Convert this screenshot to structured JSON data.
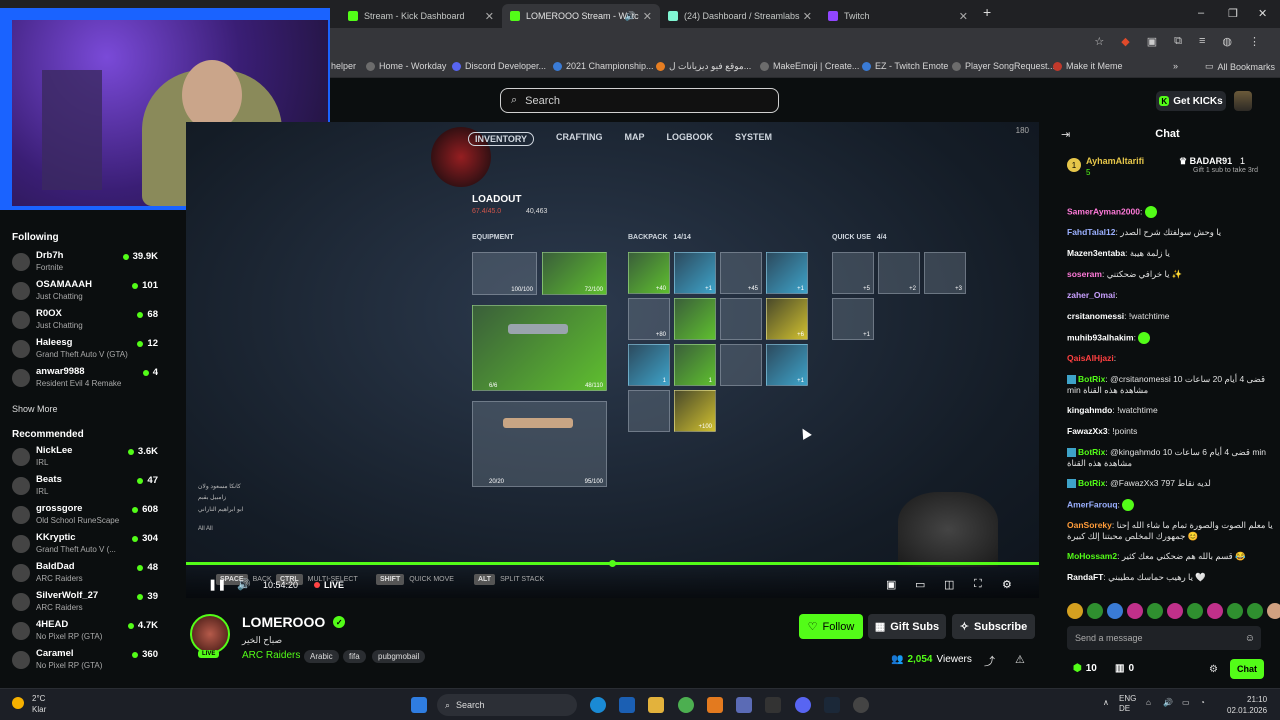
{
  "browser": {
    "tabs": [
      {
        "label": "Stream - Kick Dashboard",
        "active": false
      },
      {
        "label": "LOMEROOO Stream - Watc",
        "active": true
      },
      {
        "label": "(24) Dashboard / Streamlabs",
        "active": false
      },
      {
        "label": "Twitch",
        "active": false
      }
    ],
    "new_tab": "+",
    "window_controls": {
      "minimize": "–",
      "maximize": "❐",
      "close": "✕"
    },
    "bookmarks": [
      {
        "label": "helper"
      },
      {
        "label": "Home - Workday"
      },
      {
        "label": "Discord Developer..."
      },
      {
        "label": "2021 Championship..."
      },
      {
        "label": "موقع فيو ديزيانات ل..."
      },
      {
        "label": "MakeEmoji | Create..."
      },
      {
        "label": "EZ - Twitch Emote"
      },
      {
        "label": "Player SongRequest..."
      },
      {
        "label": "Make it Meme"
      }
    ],
    "bookmarks_more": "»",
    "all_bookmarks": "All Bookmarks"
  },
  "header": {
    "search_placeholder": "Search",
    "get_kicks": "Get KICKs"
  },
  "sidebar": {
    "following_title": "Following",
    "following": [
      {
        "name": "Drb7h",
        "category": "Fortnite",
        "viewers": "39.9K"
      },
      {
        "name": "OSAMAAAH",
        "category": "Just Chatting",
        "viewers": "101"
      },
      {
        "name": "R0OX",
        "category": "Just Chatting",
        "viewers": "68"
      },
      {
        "name": "Haleesg",
        "category": "Grand Theft Auto V (GTA)",
        "viewers": "12"
      },
      {
        "name": "anwar9988",
        "category": "Resident Evil 4 Remake",
        "viewers": "4"
      }
    ],
    "show_more": "Show More",
    "recommended_title": "Recommended",
    "recommended": [
      {
        "name": "NickLee",
        "category": "IRL",
        "viewers": "3.6K"
      },
      {
        "name": "Beats",
        "category": "IRL",
        "viewers": "47"
      },
      {
        "name": "grossgore",
        "category": "Old School RuneScape",
        "viewers": "608"
      },
      {
        "name": "KKryptic",
        "category": "Grand Theft Auto V (...",
        "viewers": "304"
      },
      {
        "name": "BaldDad",
        "category": "ARC Raiders",
        "viewers": "48"
      },
      {
        "name": "SilverWolf_27",
        "category": "ARC Raiders",
        "viewers": "39"
      },
      {
        "name": "4HEAD",
        "category": "No Pixel RP (GTA)",
        "viewers": "4.7K"
      },
      {
        "name": "Caramel",
        "category": "No Pixel RP (GTA)",
        "viewers": "360"
      }
    ]
  },
  "game": {
    "nav": [
      "INVENTORY",
      "CRAFTING",
      "MAP",
      "LOGBOOK",
      "SYSTEM"
    ],
    "fps": "180",
    "loadout_title": "LOADOUT",
    "weight": "67.4/45.0",
    "coins": "40,463",
    "equipment_label": "EQUIPMENT",
    "backpack_label": "BACKPACK",
    "backpack_count": "14/14",
    "quickuse_label": "QUICK USE",
    "quickuse_count": "4/4",
    "equip_slot1": "100/100",
    "equip_slot2": "72/100",
    "weapon1_ammo": "6/6",
    "weapon1_cap": "48/110",
    "weapon2_ammo": "20/20",
    "weapon2_cap": "95/100",
    "backpack_items": [
      "+40",
      "+1",
      "+45",
      "+1",
      "+80",
      "",
      "",
      "+6",
      "1",
      "1",
      "",
      "+1",
      "",
      "+100"
    ],
    "quick_items": [
      "+5",
      "+2",
      "+3",
      "+1"
    ],
    "hints": [
      {
        "key": "SPACE",
        "label": "BACK"
      },
      {
        "key": "SHIFT",
        "label": "QUICK MOVE"
      },
      {
        "key": "ALT",
        "label": "SPLIT STACK"
      }
    ],
    "hint_multi": "MULTI-SELECT",
    "hint_all": "All All",
    "ingame_chat": [
      "كانكا مسعود ولان",
      "زامبيل بقبم",
      "ابو ابراهيم الناراني"
    ]
  },
  "player": {
    "time": "10:54:20",
    "live": "LIVE",
    "progress_percent": 100
  },
  "stream": {
    "streamer": "LOMEROOO",
    "title": "صباح الخير",
    "category": "ARC Raiders",
    "tags": [
      "Arabic",
      "fifa",
      "pubgmobail"
    ],
    "live_label": "LIVE",
    "follow": "Follow",
    "gift_subs": "Gift Subs",
    "subscribe": "Subscribe",
    "viewers": "2,054",
    "viewers_label": "Viewers"
  },
  "chat": {
    "title": "Chat",
    "pinned": {
      "rank": "1",
      "user": "AyhamAltarifi",
      "subs": "5",
      "right_user": "BADAR91",
      "right_count": "1",
      "right_note": "Gift 1 sub to take 3rd"
    },
    "messages": [
      {
        "user": "SamerAyman2000",
        "color": "#ff7ad9",
        "text": "",
        "emote": true,
        "bot": false
      },
      {
        "user": "FahdTalal12",
        "color": "#9bb0ff",
        "text": "يا وحش سولفتك شرح الصدر",
        "emote": false,
        "bot": false
      },
      {
        "user": "Mazen3entaba",
        "color": "#ffffff",
        "text": "يا زلمة هيبة",
        "emote": false,
        "bot": false
      },
      {
        "user": "soseram",
        "color": "#ff7ad9",
        "text": "يا خرافي ضحكتني ✨",
        "emote": false,
        "bot": false
      },
      {
        "user": "zaher_Omai",
        "color": "#c9a0ff",
        "text": "",
        "emote": false,
        "bot": false
      },
      {
        "user": "crsitanomessi",
        "color": "#ffffff",
        "text": "!watchtime",
        "emote": false,
        "bot": false
      },
      {
        "user": "muhib93alhakim",
        "color": "#ffffff",
        "text": "",
        "emote": true,
        "bot": false
      },
      {
        "user": "QaisAlHjazi",
        "color": "#ff4040",
        "text": "",
        "emote": false,
        "bot": false
      },
      {
        "user": "BotRix",
        "color": "#53fc18",
        "text": "@crsitanomessi قضى 4 أيام 20 ساعات 10 min مشاهدة هذه القناة",
        "emote": false,
        "bot": true
      },
      {
        "user": "kingahmdo",
        "color": "#ffffff",
        "text": "!watchtime",
        "emote": false,
        "bot": false
      },
      {
        "user": "FawazXx3",
        "color": "#ffffff",
        "text": "!points",
        "emote": false,
        "bot": false
      },
      {
        "user": "BotRix",
        "color": "#53fc18",
        "text": "@kingahmdo قضى 4 أيام 6 ساعات 10 min مشاهدة هذه القناة",
        "emote": false,
        "bot": true
      },
      {
        "user": "BotRix",
        "color": "#53fc18",
        "text": "@FawazXx3 لديه نقاط 797",
        "emote": false,
        "bot": true
      },
      {
        "user": "AmerFarouq",
        "color": "#9bb0ff",
        "text": "",
        "emote": true,
        "bot": false
      },
      {
        "user": "OanSoreky",
        "color": "#ff9c3a",
        "text": "يا معلم الصوت والصورة تمام ما شاء الله إحنا جمهورك المخلص محبتنا إلك كبيرة 😊",
        "emote": false,
        "bot": false
      },
      {
        "user": "MoHossam2",
        "color": "#53fc18",
        "text": "قسم بالله هم ضحكني معك كثير 😂",
        "emote": false,
        "bot": false
      },
      {
        "user": "RandaFT",
        "color": "#ffffff",
        "text": "يا رهيب حماسك مطيبني 🤍",
        "emote": false,
        "bot": false
      }
    ],
    "input_placeholder": "Send a message",
    "points": "10",
    "gifts": "0",
    "send": "Chat"
  },
  "taskbar": {
    "temp": "2°C",
    "weather": "Klar",
    "search": "Search",
    "lang1": "ENG",
    "lang2": "DE",
    "time": "21:10",
    "date": "02.01.2026"
  }
}
